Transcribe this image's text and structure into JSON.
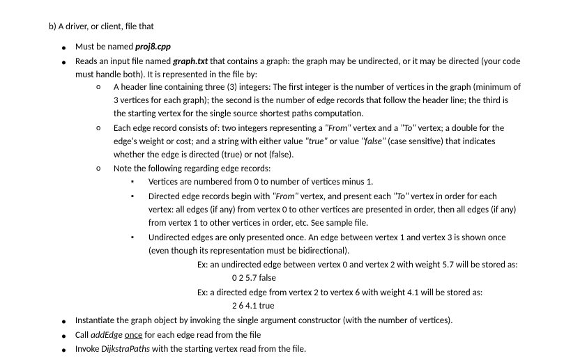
{
  "heading": "b) A driver, or client, file that",
  "b1": {
    "pre": "Must be named ",
    "emph": "proj8.cpp"
  },
  "b2": {
    "pre": "Reads an input file named ",
    "emph": "graph.txt",
    "post": " that contains a graph: the graph may be undirected, or it may be directed (your code must handle both). It is represented in the file by:"
  },
  "c1": "A header line containing three (3) integers: The first integer is the number of vertices in the graph (minimum of 3 vertices for each graph); the second is the number of edge records that follow the header line; the third is the starting vertex for the single source shortest paths computation.",
  "c2": {
    "p1": "Each edge record consists of: two integers representing a ",
    "q1": "\"From\"",
    "p2": " vertex and a ",
    "q2": "\"To\"",
    "p3": " vertex; a double for the edge's weight or cost; and a string with either value ",
    "q3": "\"true\"",
    "p4": " or value ",
    "q4": "\"false\"",
    "p5": " (case sensitive) that indicates whether the edge is directed (true) or not (false)."
  },
  "c3": "Note the following regarding edge records:",
  "s1": "Vertices are numbered from 0 to number of vertices minus 1.",
  "s2": {
    "p1": "Directed edge records begin with ",
    "q1": "\"From\"",
    "p2": " vertex, and present each ",
    "q2": "\"To\"",
    "p3": " vertex in order for each vertex: all edges (if any) from vertex 0 to other vertices are presented in order, then all edges (if any) from vertex 1 to other vertices in order, etc.  See sample file."
  },
  "s3": "Undirected edges are only presented once.  An edge between vertex 1 and vertex 3 is shown once (even though its representation must be bidirectional).",
  "ex1_line": "Ex: an undirected edge between vertex 0 and vertex 2 with weight 5.7 will be stored as:",
  "ex1_code": "0  2  5.7  false",
  "ex2_line": "Ex: a directed edge from vertex 2 to vertex 6 with weight 4.1 will be stored as:",
  "ex2_code": "2  6  4.1  true",
  "b3": "Instantiate the graph object by invoking the single argument constructor (with the number of vertices).",
  "b4": {
    "p1": "Call ",
    "emph": "addEdge",
    "p2": " ",
    "u": "once",
    "p3": " for each edge read from the file"
  },
  "b5": {
    "p1": "Invoke ",
    "emph": "DijkstraPaths",
    "p2": " with the starting vertex read from the file."
  }
}
